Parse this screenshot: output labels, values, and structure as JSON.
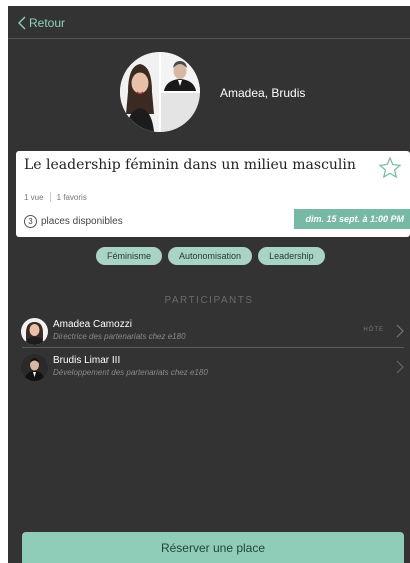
{
  "nav": {
    "back_label": "Retour"
  },
  "host": {
    "names": "Amadea, Brudis"
  },
  "event": {
    "title": "Le leadership féminin dans un milieu masculin",
    "views": "1 vue",
    "favorites": "1 favoris",
    "places_count": "3",
    "places_label": "places disponibles",
    "date": "dim. 15 sept. à 1:00 PM"
  },
  "tags": [
    "Féminisme",
    "Autonomisation",
    "Leadership"
  ],
  "participants": {
    "title": "PARTICIPANTS",
    "items": [
      {
        "name": "Amadea Camozzi",
        "role": "Directrice des partenariats chez e180",
        "badge": "HÔTE"
      },
      {
        "name": "Brudis Limar III",
        "role": "Développement des partenariats chez e180"
      }
    ]
  },
  "actions": {
    "reserve_label": "Réserver une place"
  },
  "colors": {
    "background": "#333333",
    "accent": "#8fd3be",
    "badge": "#77b9a4",
    "tag": "#a9d3c5",
    "button": "#8fcdb9"
  }
}
